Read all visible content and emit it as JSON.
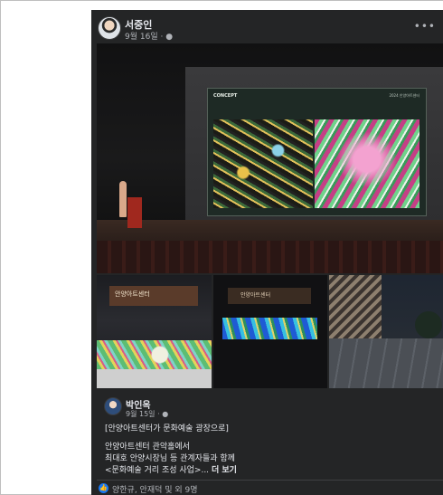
{
  "post": {
    "author": "서중인",
    "date": "9월 16일",
    "privacy_icon": "globe-icon",
    "more_icon": "more-options-icon"
  },
  "main_photo": {
    "screen_title": "CONCEPT",
    "screen_subtitle": "2024 안양아트센터"
  },
  "thumbnails": {
    "t1_sign": "안양아트센터",
    "t2_sign": "안양아트센터"
  },
  "shared_post": {
    "author": "박인옥",
    "date": "9월 15일",
    "line1": "[안양아트센터가 문화예술 광장으로]",
    "line2": "안양아트센터 관악홀에서",
    "line3": "최대호 안양시장님 등 관계자들과 함께",
    "line4": "<문화예술 거리 조성 사업>...",
    "see_more": "더 보기"
  },
  "reactions": {
    "text": "양한규, 안재덕 및 외 9명",
    "icon": "like-icon",
    "color": "#1877f2"
  }
}
